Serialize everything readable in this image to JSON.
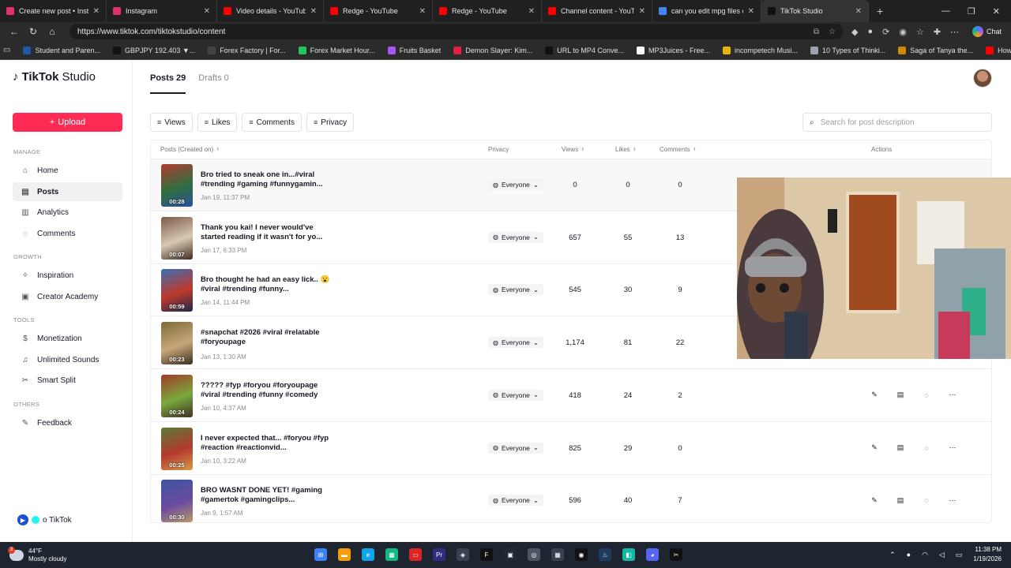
{
  "browser": {
    "tabs": [
      {
        "title": "Create new post • Instagram",
        "color": "#e1306c",
        "active": false
      },
      {
        "title": "Instagram",
        "color": "#e1306c",
        "active": false
      },
      {
        "title": "Video details - YouTube Studio",
        "color": "#ff0000",
        "active": false
      },
      {
        "title": "Redge - YouTube",
        "color": "#ff0000",
        "active": false
      },
      {
        "title": "Redge - YouTube",
        "color": "#ff0000",
        "active": false
      },
      {
        "title": "Channel content - YouTube Studio",
        "color": "#ff0000",
        "active": false
      },
      {
        "title": "can you edit mpg files on ca...",
        "color": "#4285f4",
        "active": false
      },
      {
        "title": "TikTok Studio",
        "color": "#111111",
        "active": true
      }
    ],
    "url": "https://www.tiktok.com/tiktokstudio/content",
    "chat_label": "Chat",
    "bookmarks": [
      {
        "label": "Student and Paren...",
        "color": "#1e5aa8"
      },
      {
        "label": "GBPJPY 192.403 ▼...",
        "color": "#111111"
      },
      {
        "label": "Forex Factory | For...",
        "color": "#444444"
      },
      {
        "label": "Forex Market Hour...",
        "color": "#22c55e"
      },
      {
        "label": "Fruits Basket",
        "color": "#a855f7"
      },
      {
        "label": "Demon Slayer: Kim...",
        "color": "#e11d48"
      },
      {
        "label": "URL to MP4 Conve...",
        "color": "#111111"
      },
      {
        "label": "MP3Juices - Free...",
        "color": "#ffffff"
      },
      {
        "label": "incompetech Musi...",
        "color": "#eab308"
      },
      {
        "label": "10 Types of Thinki...",
        "color": "#9ca3af"
      },
      {
        "label": "Saga of Tanya the...",
        "color": "#ca8a04"
      },
      {
        "label": "How to Fix Screen...",
        "color": "#ff0000"
      }
    ]
  },
  "sidebar": {
    "brand": "TikTok",
    "brand_suffix": "Studio",
    "upload_label": "Upload",
    "sections": {
      "manage": "MANAGE",
      "growth": "GROWTH",
      "tools": "TOOLS",
      "others": "OTHERS"
    },
    "items": {
      "home": "Home",
      "posts": "Posts",
      "analytics": "Analytics",
      "comments": "Comments",
      "inspiration": "Inspiration",
      "academy": "Creator Academy",
      "monetization": "Monetization",
      "sounds": "Unlimited Sounds",
      "split": "Smart Split",
      "feedback": "Feedback"
    },
    "footer_label": "o TikTok"
  },
  "main": {
    "tabs": [
      {
        "label": "Posts 29",
        "active": true
      },
      {
        "label": "Drafts 0",
        "active": false
      }
    ],
    "filters": [
      "Views",
      "Likes",
      "Comments",
      "Privacy"
    ],
    "search_placeholder": "Search for post description",
    "columns": {
      "posts": "Posts (Created on)",
      "privacy": "Privacy",
      "views": "Views",
      "likes": "Likes",
      "comments": "Comments",
      "actions": "Actions"
    },
    "rows": [
      {
        "desc": "Bro tried to sneak one in...#viral #trending #gaming #funnygamin...",
        "date": "Jan 19, 11:37 PM",
        "duration": "00:28",
        "privacy": "Everyone",
        "views": "0",
        "likes": "0",
        "comments": "0"
      },
      {
        "desc": "Thank you kai! I never would've started reading if it wasn't for yo...",
        "date": "Jan 17, 6:33 PM",
        "duration": "00:07",
        "privacy": "Everyone",
        "views": "657",
        "likes": "55",
        "comments": "13"
      },
      {
        "desc": "Bro thought he had an easy lick.. 😮 #viral #trending #funny...",
        "date": "Jan 14, 11:44 PM",
        "duration": "00:59",
        "privacy": "Everyone",
        "views": "545",
        "likes": "30",
        "comments": "9"
      },
      {
        "desc": "#snapchat #2026 #viral #relatable #foryoupage",
        "date": "Jan 13, 1:30 AM",
        "duration": "00:23",
        "privacy": "Everyone",
        "views": "1,174",
        "likes": "81",
        "comments": "22"
      },
      {
        "desc": "????? #fyp #foryou #foryoupage #viral #trending #funny #comedy",
        "date": "Jan 10, 4:37 AM",
        "duration": "00:24",
        "privacy": "Everyone",
        "views": "418",
        "likes": "24",
        "comments": "2"
      },
      {
        "desc": "I never expected that... #foryou #fyp #reaction #reactionvid...",
        "date": "Jan 10, 3:22 AM",
        "duration": "00:25",
        "privacy": "Everyone",
        "views": "825",
        "likes": "29",
        "comments": "0"
      },
      {
        "desc": "BRO WASNT DONE YET! #gaming #gamertok #gamingclips...",
        "date": "Jan 9, 1:57 AM",
        "duration": "00:30",
        "privacy": "Everyone",
        "views": "596",
        "likes": "40",
        "comments": "7"
      }
    ]
  },
  "taskbar": {
    "temp": "44°F",
    "condition": "Mostly cloudy",
    "weather_badge": "3",
    "time": "11:38 PM",
    "date": "1/19/2026"
  },
  "colors": {
    "accent": "#fe2c55"
  }
}
